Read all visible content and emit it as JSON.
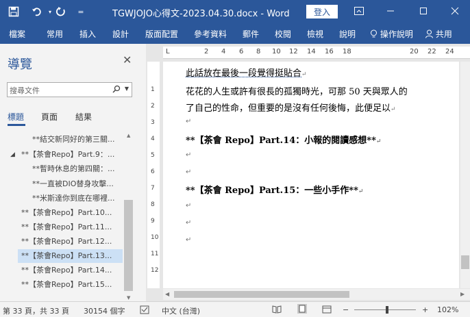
{
  "titlebar": {
    "title": "TGWJOJO心得文-2023.04.30.docx  -  Word",
    "login": "登入",
    "icons": [
      "save-icon",
      "undo-icon",
      "redo-icon",
      "customize-icon",
      "ribbon-display-icon",
      "minimize-icon",
      "maximize-icon",
      "close-icon"
    ]
  },
  "ribbon": {
    "tabs": [
      "檔案",
      "常用",
      "插入",
      "設計",
      "版面配置",
      "參考資料",
      "郵件",
      "校閱",
      "檢視",
      "說明",
      "操作說明",
      "共用"
    ]
  },
  "nav": {
    "title": "導覽",
    "search_placeholder": "搜尋文件",
    "tabs": [
      "標題",
      "頁面",
      "結果"
    ],
    "items": [
      {
        "text": "**結交新同好的第三關..."
      },
      {
        "text": "**【茶會Repo】Part.9：..."
      },
      {
        "text": "**暫時休息的第四關：..."
      },
      {
        "text": "**一直被DIO替身攻擊..."
      },
      {
        "text": "**米斯達你到底在哪裡..."
      },
      {
        "text": "**【茶會Repo】Part.10..."
      },
      {
        "text": "**【茶會Repo】Part.11..."
      },
      {
        "text": "**【茶會Repo】Part.12..."
      },
      {
        "text": "**【茶會Repo】Part.13..."
      },
      {
        "text": "**【茶會Repo】Part.14..."
      },
      {
        "text": "**【茶會Repo】Part.15..."
      }
    ]
  },
  "ruler": {
    "h_labels": [
      "2",
      "4",
      "6",
      "8",
      "10",
      "12",
      "14",
      "16",
      "18",
      "20",
      "22",
      "24"
    ],
    "v_labels": [
      "1",
      "2",
      "3",
      "4",
      "5",
      "6",
      "7",
      "8",
      "9",
      "10",
      "11",
      "12",
      "13"
    ]
  },
  "document": {
    "line1": "此話放在最後一段覺得挺貼合",
    "line2": "花花的人生或許有很長的孤獨時光，可那 50 天與眾人的",
    "line3": "了自己的性命，但重要的是沒有任何後悔，此便足以",
    "heading14": "**【茶會 Repo】Part.14：小報的閱讀感想**",
    "heading15": "**【茶會 Repo】Part.15：一些小手作**",
    "pilcrow": "↵"
  },
  "status": {
    "page": "第 33 頁，共 33 頁",
    "words": "30154 個字",
    "language": "中文 (台灣)",
    "zoom": "102%",
    "zoom_minus": "−",
    "zoom_plus": "+"
  }
}
